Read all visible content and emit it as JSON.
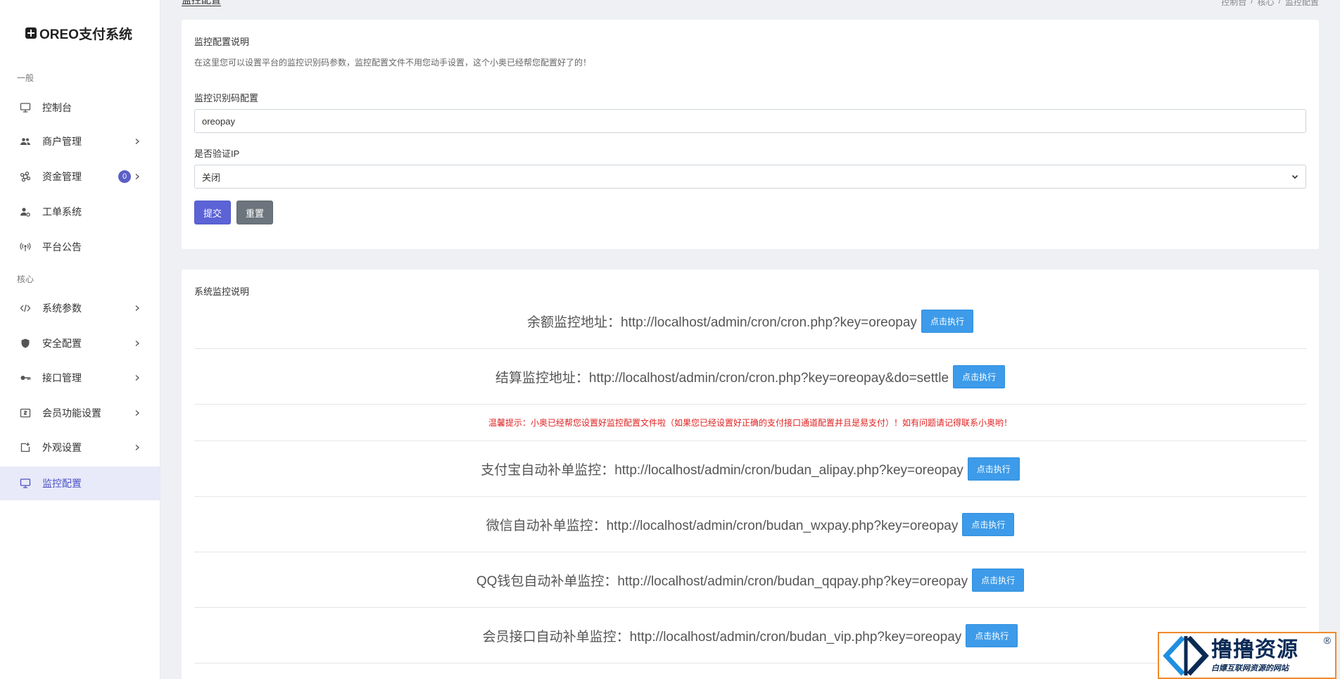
{
  "app": {
    "brand": "OREO支付系统"
  },
  "sidebar": {
    "section_general": "一般",
    "section_core": "核心",
    "items": [
      {
        "label": "控制台",
        "icon": "monitor-icon"
      },
      {
        "label": "商户管理",
        "icon": "users-icon"
      },
      {
        "label": "资金管理",
        "icon": "command-icon",
        "badge": "0"
      },
      {
        "label": "工单系统",
        "icon": "user-gear-icon"
      },
      {
        "label": "平台公告",
        "icon": "broadcast-icon"
      },
      {
        "label": "系统参数",
        "icon": "code-icon"
      },
      {
        "label": "安全配置",
        "icon": "shield-icon"
      },
      {
        "label": "接口管理",
        "icon": "key-icon"
      },
      {
        "label": "会员功能设置",
        "icon": "money-icon"
      },
      {
        "label": "外观设置",
        "icon": "expand-icon"
      },
      {
        "label": "监控配置",
        "icon": "monitor-icon",
        "active": true
      }
    ]
  },
  "header": {
    "title": "监控配置",
    "breadcrumb": [
      "控制台",
      "/",
      "核心",
      "/",
      "监控配置"
    ]
  },
  "config_card": {
    "title": "监控配置说明",
    "description": "在这里您可以设置平台的监控识别码参数，监控配置文件不用您动手设置，这个小奥已经帮您配置好了的！",
    "code_label": "监控识别码配置",
    "code_value": "oreopay",
    "verify_ip_label": "是否验证IP",
    "verify_ip_value": "关闭",
    "submit_label": "提交",
    "reset_label": "重置"
  },
  "monitor_card": {
    "title": "系统监控说明",
    "run_label": "点击执行",
    "tip": "温馨提示：小奥已经帮您设置好监控配置文件啦（如果您已经设置好正确的支付接口通道配置并且是易支付）！如有问题请记得联系小奥哟！",
    "rows": [
      "余额监控地址：http://localhost/admin/cron/cron.php?key=oreopay",
      "结算监控地址：http://localhost/admin/cron/cron.php?key=oreopay&do=settle",
      "支付宝自动补单监控：http://localhost/admin/cron/budan_alipay.php?key=oreopay",
      "微信自动补单监控：http://localhost/admin/cron/budan_wxpay.php?key=oreopay",
      "QQ钱包自动补单监控：http://localhost/admin/cron/budan_qqpay.php?key=oreopay",
      "会员接口自动补单监控：http://localhost/admin/cron/budan_vip.php?key=oreopay"
    ]
  },
  "watermark": {
    "main": "撸撸资源",
    "sub": "白嫖互联网资源的网站",
    "reg": "®"
  },
  "colors": {
    "primary": "#5c63d6",
    "run_button": "#3d9be9",
    "tip": "#e02020",
    "sidebar_active_bg": "#e8eaf9"
  }
}
